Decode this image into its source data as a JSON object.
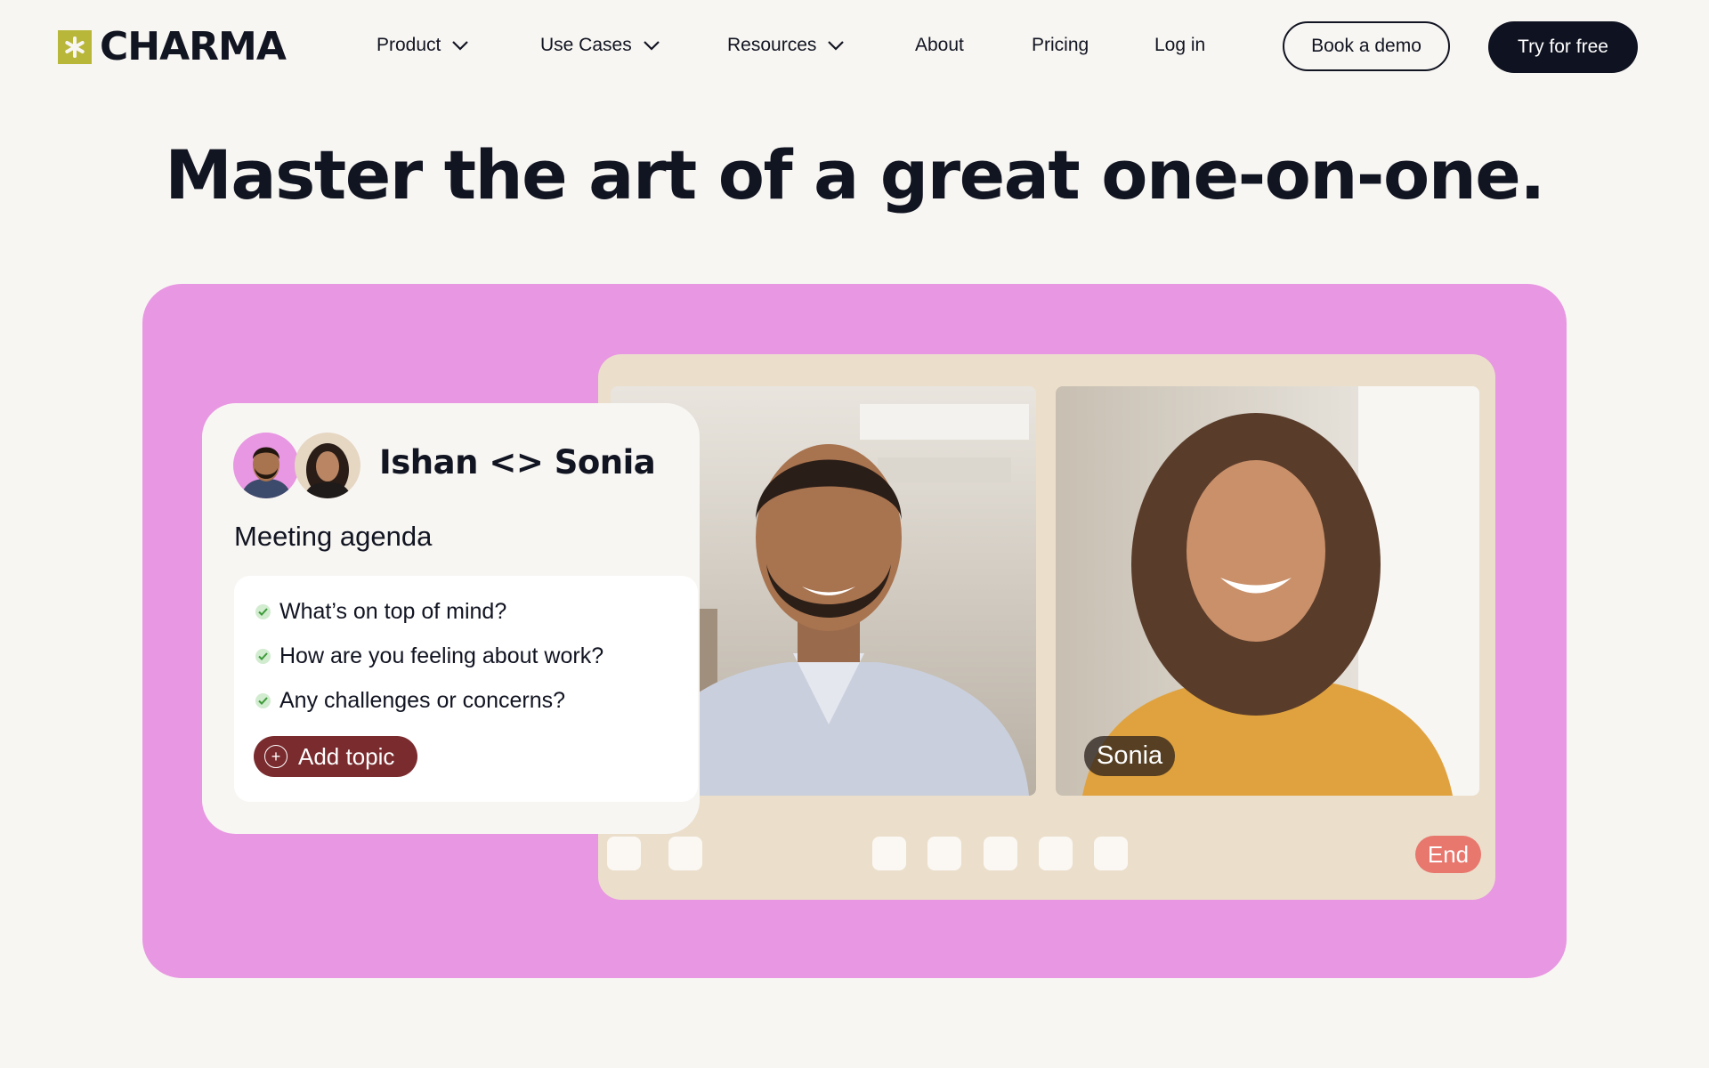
{
  "nav": {
    "logo_text": "CHARMA",
    "items": [
      {
        "label": "Product",
        "dropdown": true
      },
      {
        "label": "Use Cases",
        "dropdown": true
      },
      {
        "label": "Resources",
        "dropdown": true
      },
      {
        "label": "About",
        "dropdown": false
      },
      {
        "label": "Pricing",
        "dropdown": false
      },
      {
        "label": "Log in",
        "dropdown": false
      }
    ],
    "demo_button": "Book a demo",
    "trial_button": "Try for free"
  },
  "hero": {
    "title": "Master the art of a great one-on-one."
  },
  "meeting": {
    "title": "Ishan <> Sonia",
    "agenda_label": "Meeting agenda",
    "topics": [
      "What’s on top of mind?",
      "How are you feeling about work?",
      "Any challenges or concerns?"
    ],
    "add_topic": "Add topic"
  },
  "video": {
    "participant_name": "Sonia",
    "end_label": "End"
  },
  "colors": {
    "background": "#f8f6f3",
    "brand_dark": "#0f1220",
    "logo_accent": "#b8b73a",
    "card_pink": "#e897e2",
    "video_frame": "#ebdfcc",
    "add_topic": "#7a2b2e",
    "end_button": "#e8776e"
  }
}
